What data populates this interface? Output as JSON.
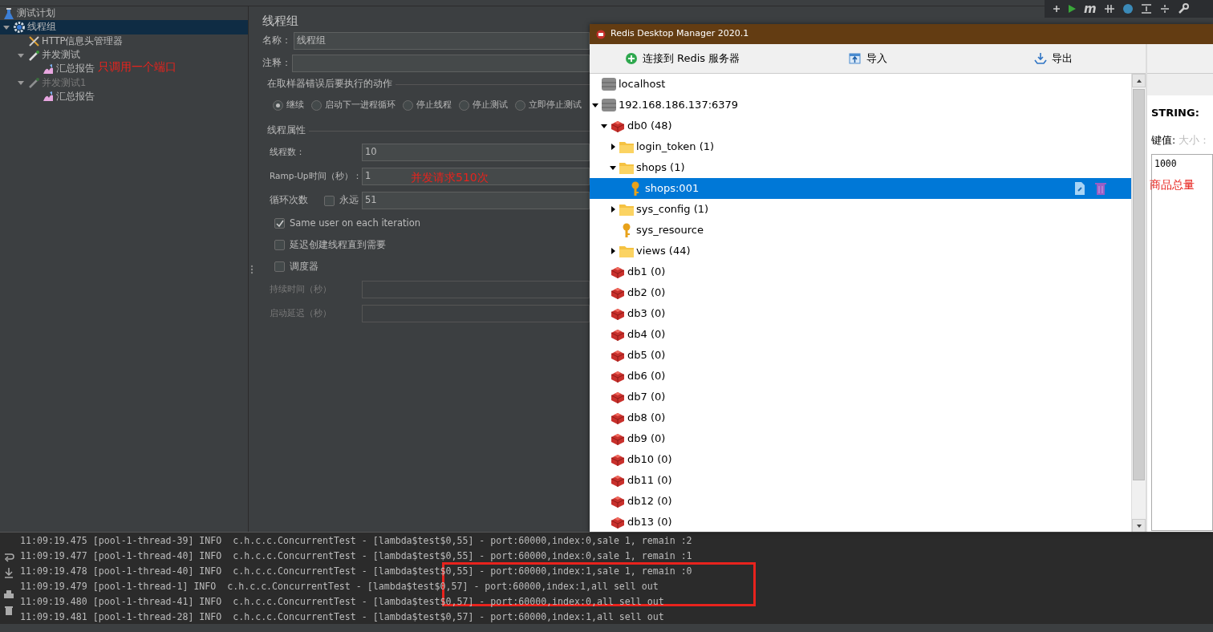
{
  "top_toolbar": {
    "m_label": "m"
  },
  "jmeter": {
    "tree": [
      {
        "label": "测试计划",
        "kind": "plan",
        "selected": false,
        "disabled": false,
        "children": [
          {
            "label": "线程组",
            "kind": "thread_group",
            "selected": true,
            "disabled": false,
            "expanded": true,
            "children": [
              {
                "label": "HTTP信息头管理器",
                "kind": "header_manager",
                "selected": false,
                "disabled": false
              },
              {
                "label": "并发测试",
                "kind": "sampler",
                "selected": false,
                "disabled": false,
                "expanded": true,
                "children": [
                  {
                    "label": "汇总报告",
                    "kind": "report",
                    "selected": false,
                    "disabled": false
                  }
                ]
              },
              {
                "label": "并发测试1",
                "kind": "sampler",
                "selected": false,
                "disabled": true,
                "expanded": true,
                "children": [
                  {
                    "label": "汇总报告",
                    "kind": "report",
                    "selected": false,
                    "disabled": false
                  }
                ]
              }
            ]
          }
        ]
      }
    ],
    "tree_note": "只调用一个端口",
    "form": {
      "title": "线程组",
      "name": {
        "label": "名称：",
        "value": "线程组"
      },
      "comment": {
        "label": "注释："
      },
      "error_action": {
        "legend": "在取样器错误后要执行的动作",
        "options": [
          {
            "label": "继续",
            "selected": true
          },
          {
            "label": "启动下一进程循环",
            "selected": false
          },
          {
            "label": "停止线程",
            "selected": false
          },
          {
            "label": "停止测试",
            "selected": false
          },
          {
            "label": "立即停止测试",
            "selected": false
          }
        ]
      },
      "thread_props": {
        "legend": "线程属性",
        "rows": [
          {
            "kind": "field",
            "label": "线程数：",
            "value": "10",
            "disabled": false
          },
          {
            "kind": "field",
            "label": "Ramp-Up时间（秒）：",
            "value": "1",
            "disabled": false
          },
          {
            "kind": "loop",
            "label": "循环次数",
            "check_label": "永远",
            "checked": false,
            "value": "51",
            "disabled": false
          },
          {
            "kind": "check",
            "label": "Same user on each iteration",
            "checked": true
          },
          {
            "kind": "check",
            "label": "延迟创建线程直到需要",
            "checked": false
          },
          {
            "kind": "check",
            "label": "调度器",
            "checked": false
          },
          {
            "kind": "field",
            "label": "持续时间（秒）",
            "disabled": true
          },
          {
            "kind": "field",
            "label": "启动延迟（秒）",
            "disabled": true
          }
        ]
      },
      "note": "并发请求510次"
    }
  },
  "redis": {
    "title": "Redis Desktop Manager 2020.1",
    "toolbar": [
      {
        "label": "连接到 Redis 服务器",
        "kind": "connect"
      },
      {
        "label": "导入",
        "kind": "import"
      },
      {
        "label": "导出",
        "kind": "export"
      }
    ],
    "tree": [
      {
        "label": "localhost",
        "kind": "server",
        "selected": false
      },
      {
        "label": "192.168.186.137:6379",
        "kind": "server",
        "selected": false,
        "expanded": true,
        "children": [
          {
            "label": "db0  (48)",
            "kind": "db",
            "selected": false,
            "expanded": true,
            "children": [
              {
                "label": "login_token (1)",
                "kind": "folder",
                "selected": false,
                "expanded": false
              },
              {
                "label": "shops (1)",
                "kind": "folder",
                "selected": false,
                "expanded": true,
                "children": [
                  {
                    "label": "shops:001",
                    "kind": "key",
                    "selected": true
                  }
                ]
              },
              {
                "label": "sys_config (1)",
                "kind": "folder",
                "selected": false,
                "expanded": false
              },
              {
                "label": "sys_resource",
                "kind": "key",
                "selected": false
              },
              {
                "label": "views (44)",
                "kind": "folder",
                "selected": false,
                "expanded": false
              }
            ]
          },
          {
            "label": "db1  (0)",
            "kind": "db",
            "selected": false
          },
          {
            "label": "db2  (0)",
            "kind": "db",
            "selected": false
          },
          {
            "label": "db3  (0)",
            "kind": "db",
            "selected": false
          },
          {
            "label": "db4  (0)",
            "kind": "db",
            "selected": false
          },
          {
            "label": "db5  (0)",
            "kind": "db",
            "selected": false
          },
          {
            "label": "db6  (0)",
            "kind": "db",
            "selected": false
          },
          {
            "label": "db7  (0)",
            "kind": "db",
            "selected": false
          },
          {
            "label": "db8  (0)",
            "kind": "db",
            "selected": false
          },
          {
            "label": "db9  (0)",
            "kind": "db",
            "selected": false
          },
          {
            "label": "db10  (0)",
            "kind": "db",
            "selected": false
          },
          {
            "label": "db11  (0)",
            "kind": "db",
            "selected": false
          },
          {
            "label": "db12  (0)",
            "kind": "db",
            "selected": false
          },
          {
            "label": "db13  (0)",
            "kind": "db",
            "selected": false
          }
        ]
      }
    ],
    "value_panel": {
      "type_label": "STRING:",
      "key_label": "键值:",
      "size_label": "大小：",
      "value": "1000",
      "note": "商品总量"
    }
  },
  "log": {
    "lines": [
      "11:09:19.475 [pool-1-thread-39] INFO  c.h.c.c.ConcurrentTest - [lambda$test$0,55] - port:60000,index:0,sale 1, remain :2",
      "11:09:19.477 [pool-1-thread-40] INFO  c.h.c.c.ConcurrentTest - [lambda$test$0,55] - port:60000,index:0,sale 1, remain :1",
      "11:09:19.478 [pool-1-thread-40] INFO  c.h.c.c.ConcurrentTest - [lambda$test$0,55] - port:60000,index:1,sale 1, remain :0",
      "11:09:19.479 [pool-1-thread-1] INFO  c.h.c.c.ConcurrentTest - [lambda$test$0,57] - port:60000,index:1,all sell out",
      "11:09:19.480 [pool-1-thread-41] INFO  c.h.c.c.ConcurrentTest - [lambda$test$0,57] - port:60000,index:0,all sell out",
      "11:09:19.481 [pool-1-thread-28] INFO  c.h.c.c.ConcurrentTest - [lambda$test$0,57] - port:60000,index:1,all sell out"
    ]
  }
}
